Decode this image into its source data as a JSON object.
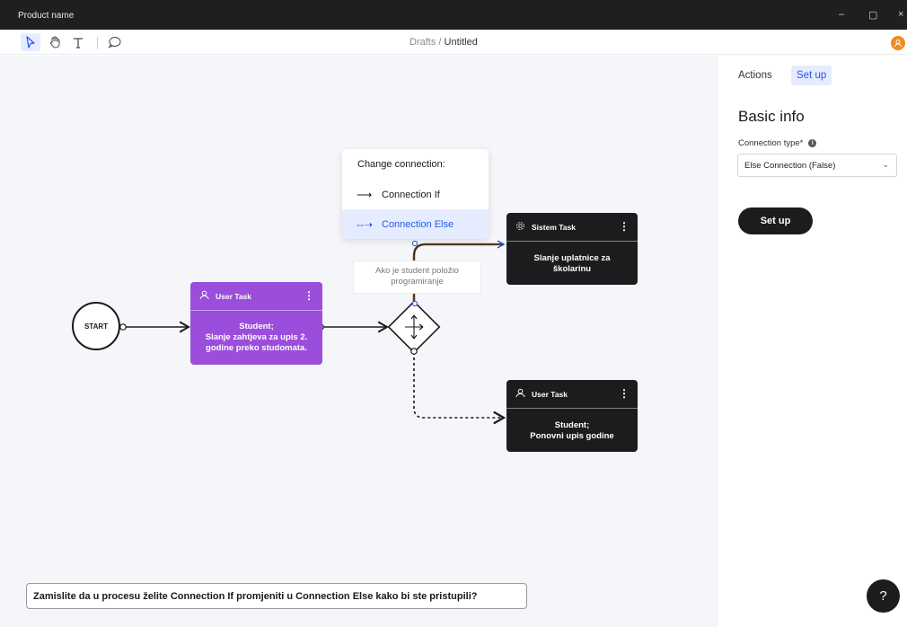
{
  "window": {
    "title": "Product name",
    "controls": [
      "–",
      "▢",
      "×"
    ]
  },
  "toolbar": {
    "tools": [
      "pointer-tool",
      "hand-tool",
      "text-tool",
      "comment-tool"
    ]
  },
  "breadcrumb": {
    "parent": "Drafts",
    "separator": " / ",
    "current": "Untitled"
  },
  "canvas": {
    "start_label": "START",
    "user_task_1": {
      "type_label": "User Task",
      "body_line1": "Student;",
      "body_line2": "Slanje zahtjeva za upis 2.",
      "body_line3": "godine preko studomata."
    },
    "sistem_task": {
      "type_label": "Sistem Task",
      "body_line1": "Slanje uplatnice za",
      "body_line2": "školarinu"
    },
    "user_task_2": {
      "type_label": "User Task",
      "body_line1": "Student;",
      "body_line2": "Ponovni upis godine"
    },
    "condition_line1": "Ako je student položio",
    "condition_line2": "programiranje",
    "popup": {
      "title": "Change connection:",
      "option_if": {
        "glyph": "⟶",
        "label": "Connection If"
      },
      "option_else": {
        "glyph": "--➝",
        "label": "Connection Else"
      }
    }
  },
  "question": "Zamislite da u procesu želite Connection If promjeniti u Connection Else kako bi ste pristupili?",
  "panel": {
    "tabs": {
      "actions": "Actions",
      "setup": "Set up"
    },
    "heading": "Basic info",
    "connection_type_label": "Connection type*",
    "connection_type_value": "Else Connection (False)",
    "setup_button": "Set up"
  },
  "help_label": "?",
  "colors": {
    "accent": "#2457e6",
    "purple_task": "#9b4ddb",
    "dark_task": "#1c1c1e",
    "highlight_connection": "#8a5a2b",
    "avatar": "#f08a24"
  }
}
